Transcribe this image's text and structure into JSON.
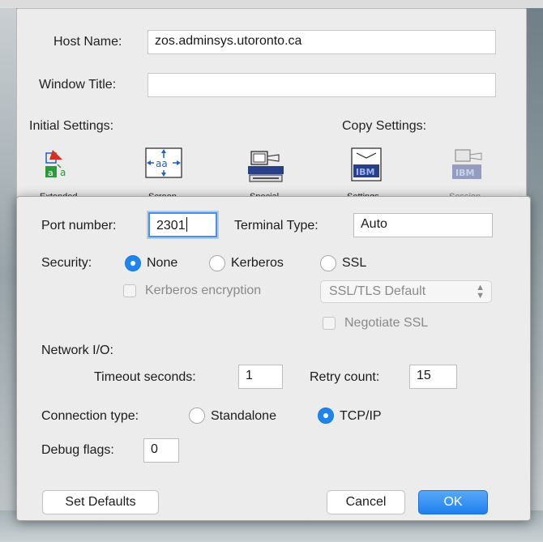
{
  "background": {
    "top_text": ""
  },
  "host_sheet": {
    "host_name_label": "Host Name:",
    "host_name_value": "zos.adminsys.utoronto.ca",
    "window_title_label": "Window Title:",
    "window_title_value": "",
    "initial_settings_label": "Initial Settings:",
    "copy_settings_label": "Copy Settings:",
    "tools": [
      {
        "icon": "extended-icon",
        "label": "Extended"
      },
      {
        "icon": "screen-icon",
        "label": "Screen"
      },
      {
        "icon": "special-icon",
        "label": "Special"
      },
      {
        "icon": "settings-icon",
        "label": "Settings"
      },
      {
        "icon": "session-icon",
        "label": "Session"
      }
    ]
  },
  "dialog": {
    "port_label": "Port number:",
    "port_value": "2301",
    "terminal_type_label": "Terminal Type:",
    "terminal_type_value": "Auto",
    "security_label": "Security:",
    "security_options": {
      "none": "None",
      "kerberos": "Kerberos",
      "ssl": "SSL"
    },
    "security_selected": "none",
    "kerberos_encryption_label": "Kerberos encryption",
    "ssl_select_value": "SSL/TLS Default",
    "negotiate_ssl_label": "Negotiate SSL",
    "network_io_label": "Network I/O:",
    "timeout_label": "Timeout seconds:",
    "timeout_value": "1",
    "retry_label": "Retry count:",
    "retry_value": "15",
    "connection_type_label": "Connection type:",
    "connection_options": {
      "standalone": "Standalone",
      "tcpip": "TCP/IP"
    },
    "connection_selected": "tcpip",
    "debug_label": "Debug flags:",
    "debug_value": "0",
    "set_defaults_label": "Set Defaults",
    "cancel_label": "Cancel",
    "ok_label": "OK",
    "accent_color": "#1e85f0"
  }
}
